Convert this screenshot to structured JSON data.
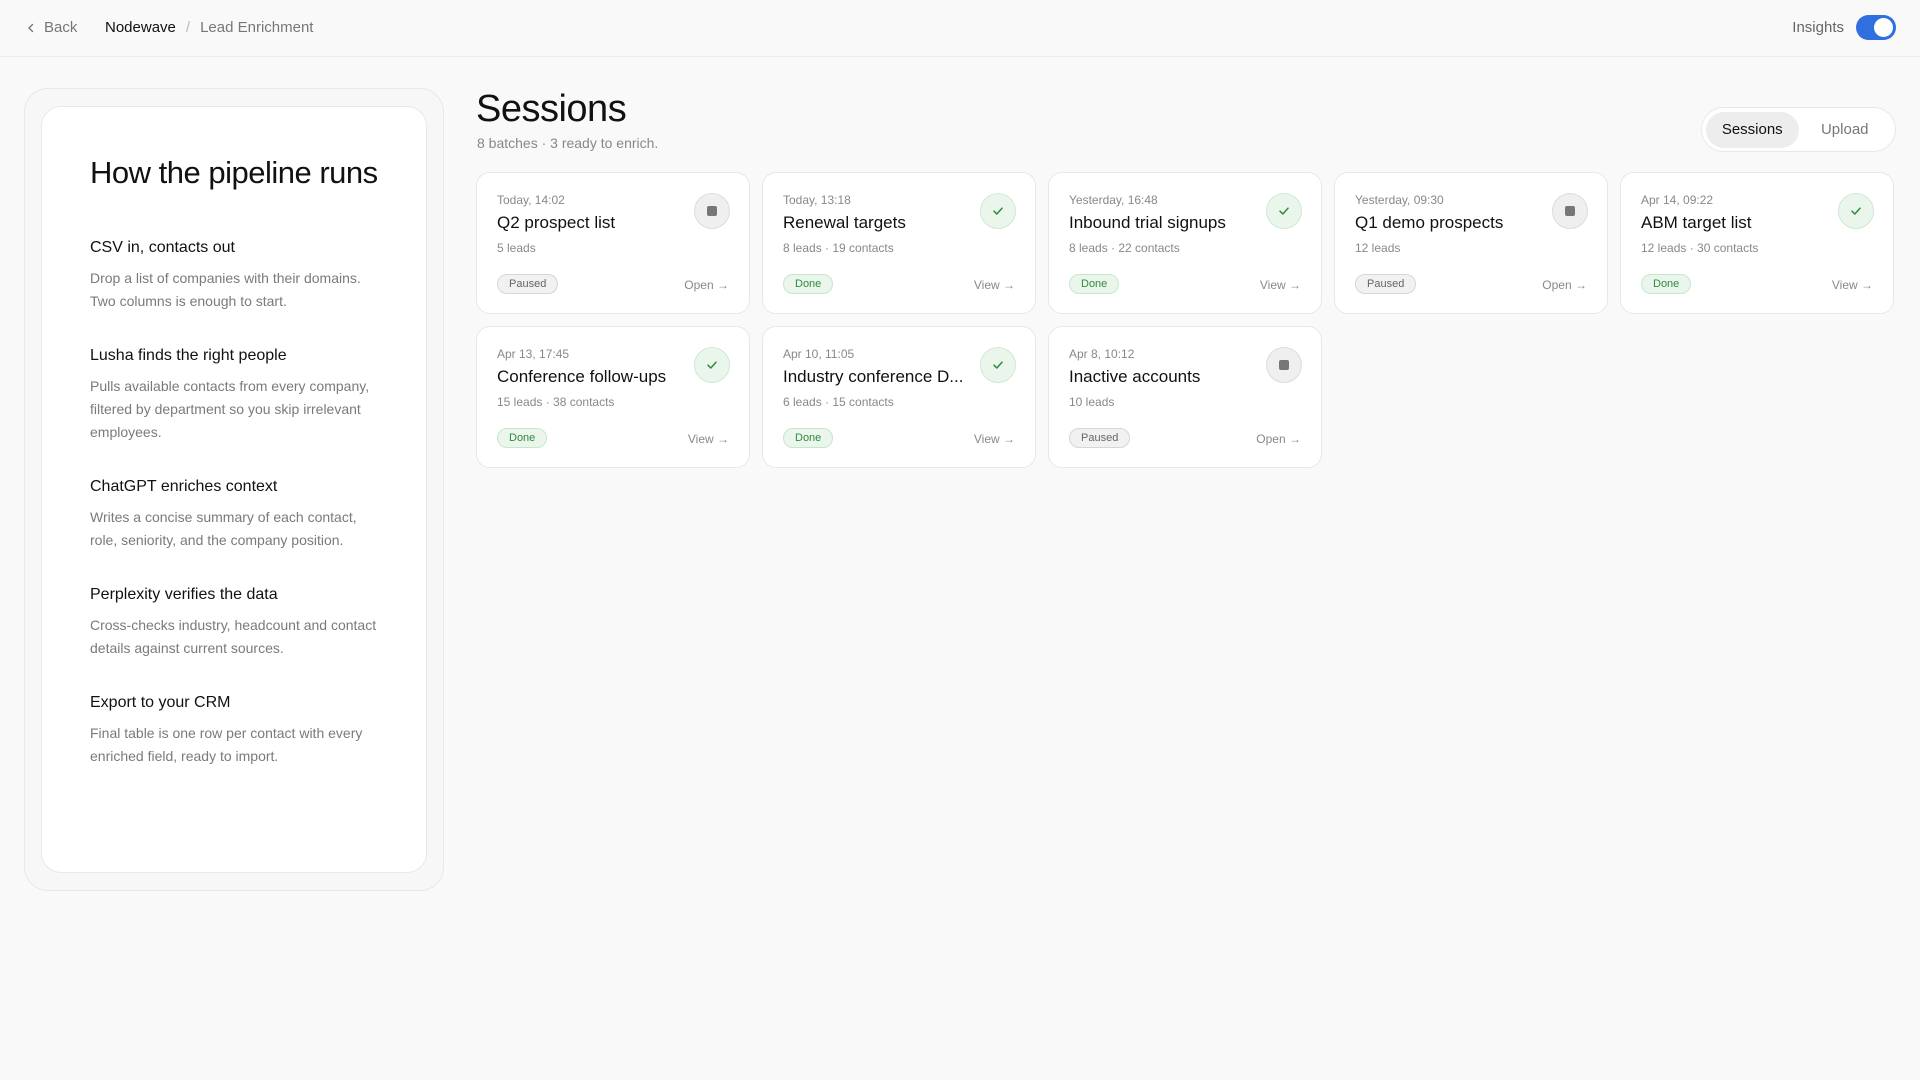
{
  "topbar": {
    "back_label": "Back",
    "breadcrumb": [
      "Nodewave",
      "/",
      "Lead Enrichment"
    ],
    "insights_label": "Insights",
    "insights_on": true,
    "accent_color": "#2f6fe0"
  },
  "pipeline": {
    "title": "How the pipeline runs",
    "steps": [
      {
        "title": "CSV in, contacts out",
        "desc": "Drop a list of companies with their domains. Two columns is enough to start."
      },
      {
        "title": "Lusha finds the right people",
        "desc": "Pulls available contacts from every company, filtered by department so you skip irrelevant employees."
      },
      {
        "title": "ChatGPT enriches context",
        "desc": "Writes a concise summary of each contact, role, seniority, and the company position."
      },
      {
        "title": "Perplexity verifies the data",
        "desc": "Cross-checks industry, headcount and contact details against current sources."
      },
      {
        "title": "Export to your CRM",
        "desc": "Final table is one row per contact with every enriched field, ready to import."
      }
    ]
  },
  "sessions": {
    "title": "Sessions",
    "subtitle": "8 batches · 3 ready to enrich.",
    "tabs": [
      "Sessions",
      "Upload"
    ],
    "active_tab": "Sessions",
    "cards": [
      {
        "date": "Today, 14:02",
        "title": "Q2 prospect list",
        "meta": "5 leads",
        "status": "Paused",
        "action": "Open →"
      },
      {
        "date": "Today, 13:18",
        "title": "Renewal targets",
        "meta": "8 leads · 19 contacts",
        "status": "Done",
        "action": "View →"
      },
      {
        "date": "Yesterday, 16:48",
        "title": "Inbound trial signups",
        "meta": "8 leads · 22 contacts",
        "status": "Done",
        "action": "View →"
      },
      {
        "date": "Yesterday, 09:30",
        "title": "Q1 demo prospects",
        "meta": "12 leads",
        "status": "Paused",
        "action": "Open →"
      },
      {
        "date": "Apr 14, 09:22",
        "title": "ABM target list",
        "meta": "12 leads · 30 contacts",
        "status": "Done",
        "action": "View →"
      },
      {
        "date": "Apr 13, 17:45",
        "title": "Conference follow-ups",
        "meta": "15 leads · 38 contacts",
        "status": "Done",
        "action": "View →"
      },
      {
        "date": "Apr 10, 11:05",
        "title": "Industry conference D...",
        "meta": "6 leads · 15 contacts",
        "status": "Done",
        "action": "View →"
      },
      {
        "date": "Apr 8, 10:12",
        "title": "Inactive accounts",
        "meta": "10 leads",
        "status": "Paused",
        "action": "Open →"
      }
    ]
  }
}
